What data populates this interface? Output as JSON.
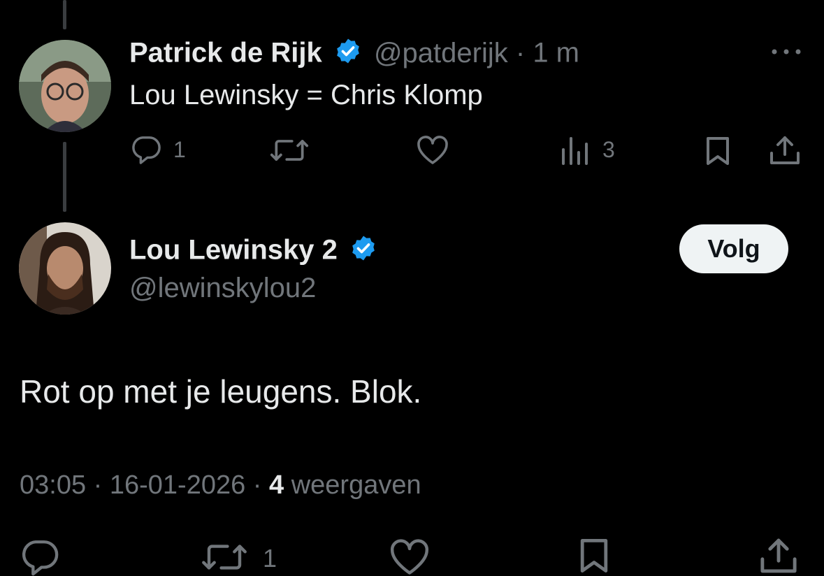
{
  "parent_tweet": {
    "author_name": "Patrick de Rijk",
    "handle": "@patderijk",
    "separator": "·",
    "time": "1 m",
    "text": "Lou Lewinsky = Chris Klomp",
    "reply_count": "1",
    "views_count": "3",
    "more_icon": "more-horizontal-icon"
  },
  "main_tweet": {
    "author_name": "Lou Lewinsky 2",
    "handle": "@lewinskylou2",
    "follow_label": "Volg",
    "text": "Rot op met je leugens. Blok.",
    "timestamp": "03:05 · 16-01-2026 ·",
    "views_number": "4",
    "views_label": "weergaven",
    "retweet_count": "1"
  },
  "colors": {
    "background": "#000000",
    "text": "#e7e9ea",
    "muted": "#71767b",
    "verified": "#1d9bf0",
    "thread_line": "#3a3d40",
    "button_bg": "#eff3f4"
  },
  "icons": [
    "reply-icon",
    "retweet-icon",
    "like-icon",
    "views-icon",
    "bookmark-icon",
    "share-icon",
    "verified-badge-icon"
  ]
}
